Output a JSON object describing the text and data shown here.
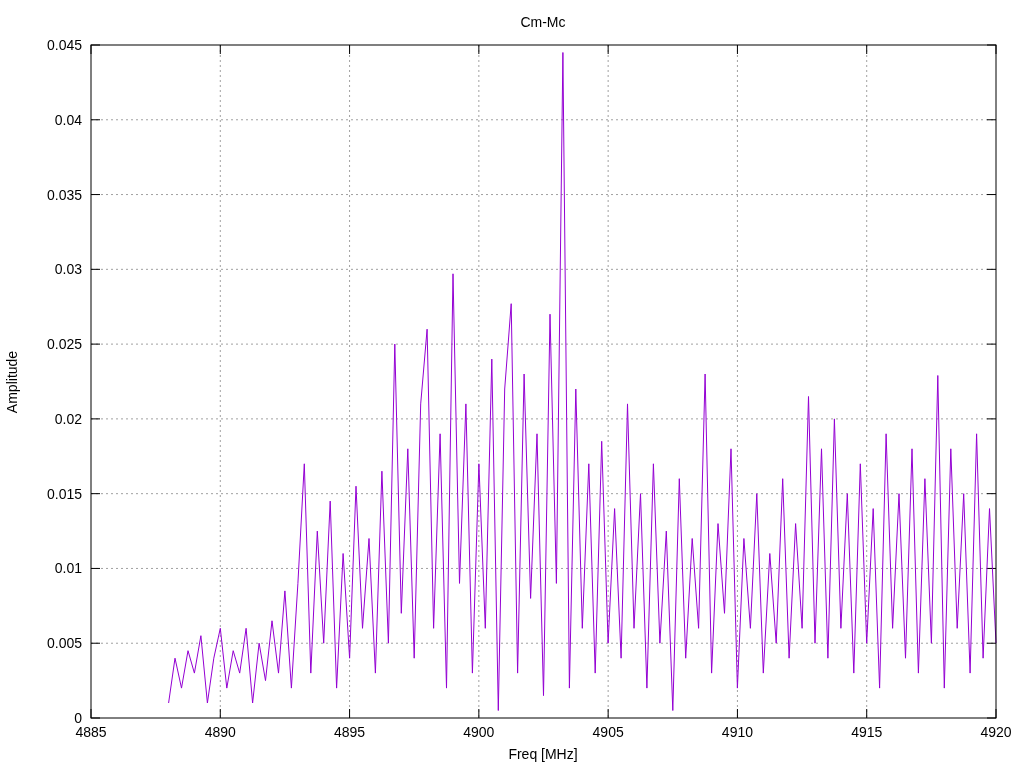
{
  "chart_data": {
    "type": "line",
    "title": "Cm-Mc",
    "xlabel": "Freq [MHz]",
    "ylabel": "Amplitude",
    "xlim": [
      4885,
      4920
    ],
    "ylim": [
      0,
      0.045
    ],
    "xticks": [
      {
        "value": 4885,
        "label": "4885"
      },
      {
        "value": 4890,
        "label": "4890"
      },
      {
        "value": 4895,
        "label": "4895"
      },
      {
        "value": 4900,
        "label": "4900"
      },
      {
        "value": 4905,
        "label": "4905"
      },
      {
        "value": 4910,
        "label": "4910"
      },
      {
        "value": 4915,
        "label": "4915"
      },
      {
        "value": 4920,
        "label": "4920"
      }
    ],
    "yticks": [
      {
        "value": 0,
        "label": "0"
      },
      {
        "value": 0.005,
        "label": "0.005"
      },
      {
        "value": 0.01,
        "label": "0.01"
      },
      {
        "value": 0.015,
        "label": "0.015"
      },
      {
        "value": 0.02,
        "label": "0.02"
      },
      {
        "value": 0.025,
        "label": "0.025"
      },
      {
        "value": 0.03,
        "label": "0.03"
      },
      {
        "value": 0.035,
        "label": "0.035"
      },
      {
        "value": 0.04,
        "label": "0.04"
      },
      {
        "value": 0.045,
        "label": "0.045"
      }
    ],
    "grid": true,
    "x": [
      4888,
      4888.25,
      4888.5,
      4888.75,
      4889,
      4889.25,
      4889.5,
      4889.75,
      4890,
      4890.25,
      4890.5,
      4890.75,
      4891,
      4891.25,
      4891.5,
      4891.75,
      4892,
      4892.25,
      4892.5,
      4892.75,
      4893,
      4893.25,
      4893.5,
      4893.75,
      4894,
      4894.25,
      4894.5,
      4894.75,
      4895,
      4895.25,
      4895.5,
      4895.75,
      4896,
      4896.25,
      4896.5,
      4896.75,
      4897,
      4897.25,
      4897.5,
      4897.75,
      4898,
      4898.25,
      4898.5,
      4898.75,
      4899,
      4899.25,
      4899.5,
      4899.75,
      4900,
      4900.25,
      4900.5,
      4900.75,
      4901,
      4901.25,
      4901.5,
      4901.75,
      4902,
      4902.25,
      4902.5,
      4902.75,
      4903,
      4903.25,
      4903.5,
      4903.75,
      4904,
      4904.25,
      4904.5,
      4904.75,
      4905,
      4905.25,
      4905.5,
      4905.75,
      4906,
      4906.25,
      4906.5,
      4906.75,
      4907,
      4907.25,
      4907.5,
      4907.75,
      4908,
      4908.25,
      4908.5,
      4908.75,
      4909,
      4909.25,
      4909.5,
      4909.75,
      4910,
      4910.25,
      4910.5,
      4910.75,
      4911,
      4911.25,
      4911.5,
      4911.75,
      4912,
      4912.25,
      4912.5,
      4912.75,
      4913,
      4913.25,
      4913.5,
      4913.75,
      4914,
      4914.25,
      4914.5,
      4914.75,
      4915,
      4915.25,
      4915.5,
      4915.75,
      4916,
      4916.25,
      4916.5,
      4916.75,
      4917,
      4917.25,
      4917.5,
      4917.75,
      4918,
      4918.25,
      4918.5,
      4918.75,
      4919,
      4919.25,
      4919.5,
      4919.75,
      4920
    ],
    "series": [
      {
        "color": "#9400d3",
        "values": [
          0.001,
          0.004,
          0.002,
          0.0045,
          0.003,
          0.0055,
          0.001,
          0.004,
          0.006,
          0.002,
          0.0045,
          0.003,
          0.006,
          0.001,
          0.005,
          0.0025,
          0.0065,
          0.003,
          0.0085,
          0.002,
          0.009,
          0.017,
          0.003,
          0.0125,
          0.005,
          0.0145,
          0.002,
          0.011,
          0.004,
          0.0155,
          0.006,
          0.012,
          0.003,
          0.0165,
          0.005,
          0.025,
          0.007,
          0.018,
          0.004,
          0.021,
          0.026,
          0.006,
          0.019,
          0.002,
          0.0297,
          0.009,
          0.021,
          0.003,
          0.017,
          0.006,
          0.024,
          0.0005,
          0.022,
          0.0277,
          0.003,
          0.023,
          0.008,
          0.019,
          0.0015,
          0.027,
          0.009,
          0.0445,
          0.002,
          0.022,
          0.006,
          0.017,
          0.003,
          0.0185,
          0.005,
          0.014,
          0.004,
          0.021,
          0.006,
          0.015,
          0.002,
          0.017,
          0.005,
          0.0125,
          0.0005,
          0.016,
          0.004,
          0.012,
          0.006,
          0.023,
          0.003,
          0.013,
          0.007,
          0.018,
          0.002,
          0.012,
          0.006,
          0.015,
          0.003,
          0.011,
          0.005,
          0.016,
          0.004,
          0.013,
          0.006,
          0.0215,
          0.005,
          0.018,
          0.004,
          0.02,
          0.006,
          0.015,
          0.003,
          0.017,
          0.005,
          0.014,
          0.002,
          0.019,
          0.006,
          0.015,
          0.004,
          0.018,
          0.003,
          0.016,
          0.005,
          0.0229,
          0.002,
          0.018,
          0.006,
          0.015,
          0.003,
          0.019,
          0.004,
          0.014,
          0.005
        ]
      }
    ]
  }
}
